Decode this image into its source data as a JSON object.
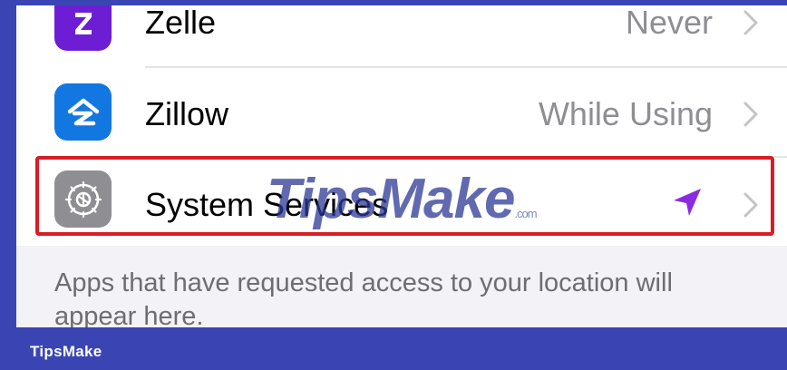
{
  "rows": [
    {
      "name": "Zelle",
      "value": "Never",
      "icon": "zelle-icon",
      "color": "#6d1ed4"
    },
    {
      "name": "Zillow",
      "value": "While Using",
      "icon": "zillow-icon",
      "color": "#1277e1"
    },
    {
      "name": "System Services",
      "value": "",
      "icon": "gear-icon",
      "color": "#8e8e93",
      "status_icon": "location-arrow-icon",
      "status_color": "#8a2be2"
    }
  ],
  "footer_note": "Apps that have requested access to your location will appear here.",
  "watermark": {
    "main": "TipsMake",
    "suffix": ".com"
  },
  "brand": "TipsMake",
  "colors": {
    "highlight": "#d81d25",
    "brand_bar": "#3a45b3"
  }
}
